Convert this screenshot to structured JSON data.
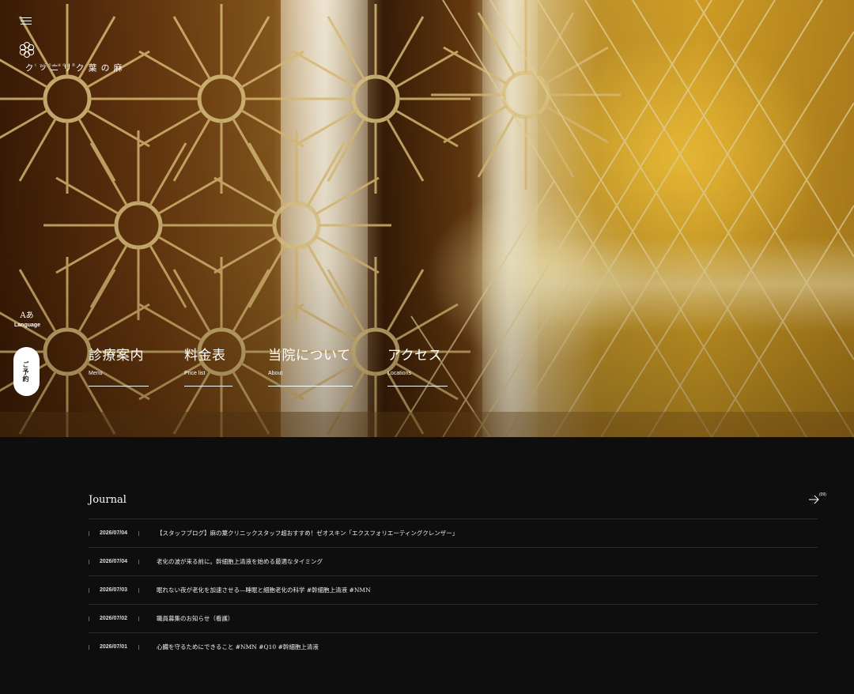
{
  "brand": {
    "name": "麻の葉クリニック",
    "ruby": "あさのはくりにっく"
  },
  "sidebar": {
    "language_label": "Language",
    "language_icon": "Aあ",
    "reserve_label": "ご予約"
  },
  "hero_nav": [
    {
      "jp": "診療案内",
      "en": "Menu"
    },
    {
      "jp": "料金表",
      "en": "Price list"
    },
    {
      "jp": "当院について",
      "en": "About"
    },
    {
      "jp": "アクセス",
      "en": "Locations"
    }
  ],
  "journal": {
    "title": "Journal",
    "count": "(09)",
    "items": [
      {
        "date": "2026/07/04",
        "title": "【スタッフブログ】麻の葉クリニックスタッフ超おすすめ！ゼオスキン「エクスフォリエーティングクレンザー」"
      },
      {
        "date": "2026/07/04",
        "title": "老化の波が来る前に。幹細胞上清液を始める最適なタイミング"
      },
      {
        "date": "2026/07/03",
        "title": "眠れない夜が老化を加速させる―睡眠と細胞老化の科学 #幹細胞上清液 #NMN"
      },
      {
        "date": "2026/07/02",
        "title": "職員募集のお知らせ（看護）"
      },
      {
        "date": "2026/07/01",
        "title": "心臓を守るためにできること #NMN #Q10 #幹細胞上清液"
      }
    ]
  },
  "colors": {
    "background": "#0e0e0e",
    "accent": "#d9a528"
  }
}
